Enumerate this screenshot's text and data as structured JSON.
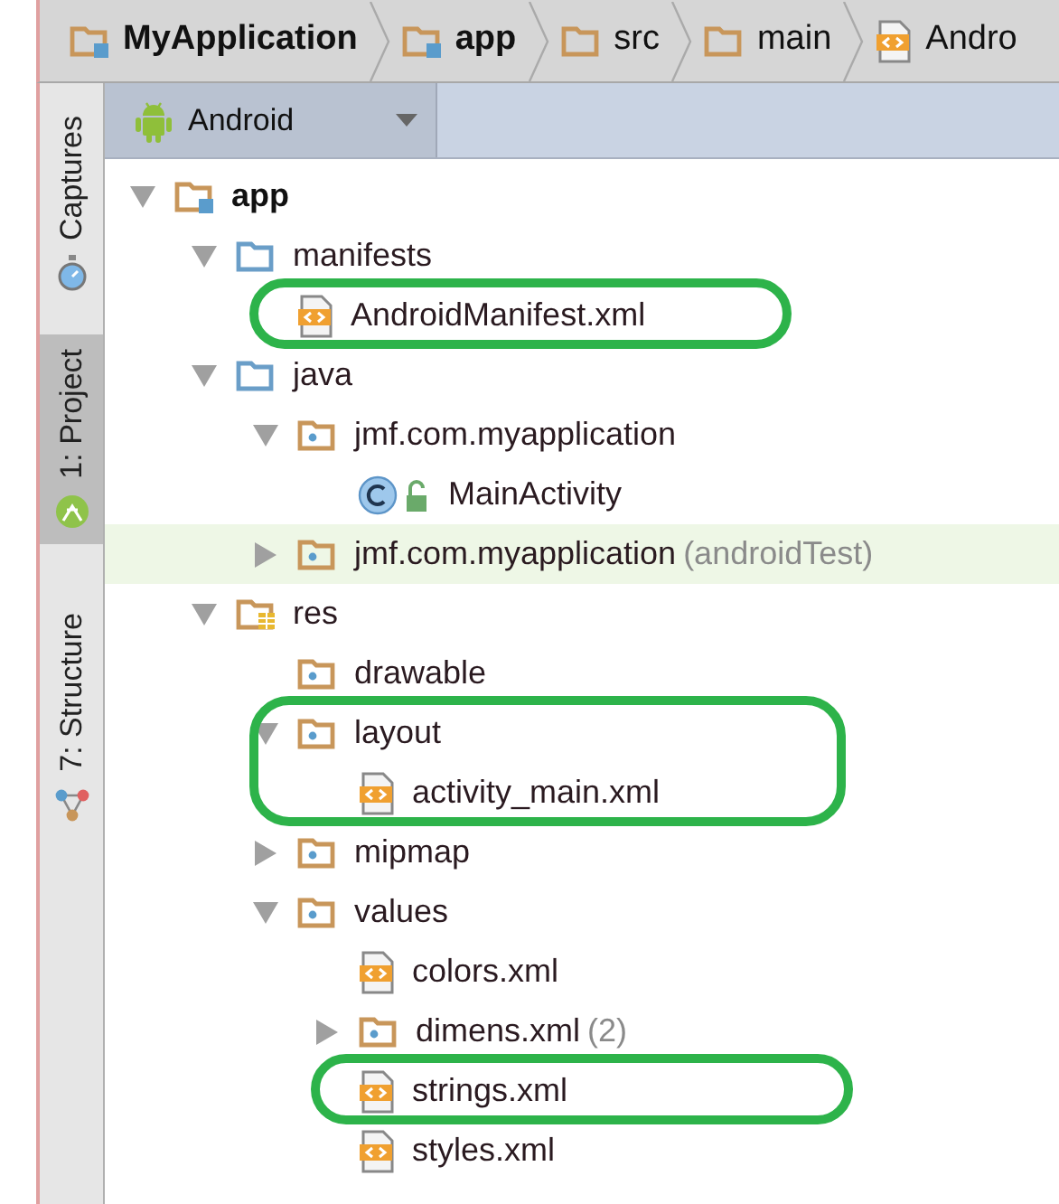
{
  "breadcrumb": [
    {
      "label": "MyApplication",
      "kind": "module"
    },
    {
      "label": "app",
      "kind": "module"
    },
    {
      "label": "src",
      "kind": "folder"
    },
    {
      "label": "main",
      "kind": "folder"
    },
    {
      "label": "Andro",
      "kind": "xml"
    }
  ],
  "side_tabs": [
    {
      "label": "Captures",
      "kind": "captures",
      "selected": false
    },
    {
      "label": "1: Project",
      "kind": "project",
      "selected": true
    },
    {
      "label": "7: Structure",
      "kind": "structure",
      "selected": false
    }
  ],
  "view_selector": {
    "label": "Android"
  },
  "tree": [
    {
      "label": "app",
      "kind": "module",
      "expanded": true,
      "selected": false,
      "children": [
        {
          "label": "manifests",
          "kind": "source-folder",
          "expanded": true,
          "selected": false,
          "children": [
            {
              "label": "AndroidManifest.xml",
              "kind": "xml",
              "selected": false,
              "circled": true
            }
          ]
        },
        {
          "label": "java",
          "kind": "source-folder",
          "expanded": true,
          "selected": false,
          "children": [
            {
              "label": "jmf.com.myapplication",
              "kind": "package",
              "expanded": true,
              "selected": false,
              "children": [
                {
                  "label": "MainActivity",
                  "kind": "class",
                  "selected": false
                }
              ]
            },
            {
              "label": "jmf.com.myapplication",
              "note": "(androidTest)",
              "kind": "package",
              "expanded": false,
              "selected": true
            }
          ]
        },
        {
          "label": "res",
          "kind": "res-folder",
          "expanded": true,
          "selected": false,
          "children": [
            {
              "label": "drawable",
              "kind": "package",
              "selected": false
            },
            {
              "label": "layout",
              "kind": "package",
              "expanded": true,
              "selected": false,
              "circled": true,
              "children": [
                {
                  "label": "activity_main.xml",
                  "kind": "xml",
                  "selected": false
                }
              ]
            },
            {
              "label": "mipmap",
              "kind": "package",
              "expanded": false,
              "selected": false
            },
            {
              "label": "values",
              "kind": "package",
              "expanded": true,
              "selected": false,
              "children": [
                {
                  "label": "colors.xml",
                  "kind": "xml",
                  "selected": false
                },
                {
                  "label": "dimens.xml",
                  "note": "(2)",
                  "kind": "package",
                  "expanded": false,
                  "selected": false
                },
                {
                  "label": "strings.xml",
                  "kind": "xml",
                  "selected": false,
                  "circled": true
                },
                {
                  "label": "styles.xml",
                  "kind": "xml",
                  "selected": false
                }
              ]
            }
          ]
        }
      ]
    }
  ]
}
